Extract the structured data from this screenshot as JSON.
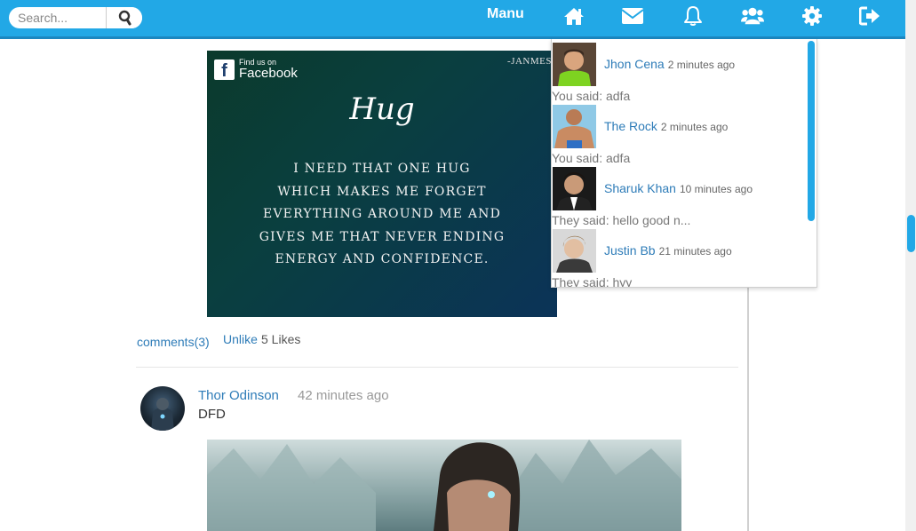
{
  "header": {
    "search_placeholder": "Search...",
    "menu_label": "Manu",
    "icons": [
      "home-icon",
      "envelope-icon",
      "bell-icon",
      "users-icon",
      "gear-icon",
      "sign-out-icon"
    ],
    "accent_color": "#22a8e6"
  },
  "post1": {
    "image": {
      "badge_small": "Find us on",
      "badge_big": "Facebook",
      "badge_letter": "f",
      "signature": "-JANMES",
      "title": "Hug",
      "lines": [
        "I need that one hug",
        "which makes me forget",
        "everything around me and",
        "gives me that never ending",
        "energy and confidence."
      ]
    },
    "comments_label": "comments(3)",
    "unlike_label": "Unlike",
    "likes_label": "5 Likes"
  },
  "post2": {
    "author": "Thor Odinson",
    "time": "42 minutes ago",
    "text": "DFD"
  },
  "messages": [
    {
      "name": "Jhon Cena",
      "time": "2 minutes ago",
      "preview": "You said: adfa"
    },
    {
      "name": "The Rock",
      "time": "2 minutes ago",
      "preview": "You said: adfa"
    },
    {
      "name": "Sharuk Khan",
      "time": "10 minutes ago",
      "preview": "They said: hello good n..."
    },
    {
      "name": "Justin Bb",
      "time": "21 minutes ago",
      "preview": "They said: hyy"
    }
  ]
}
